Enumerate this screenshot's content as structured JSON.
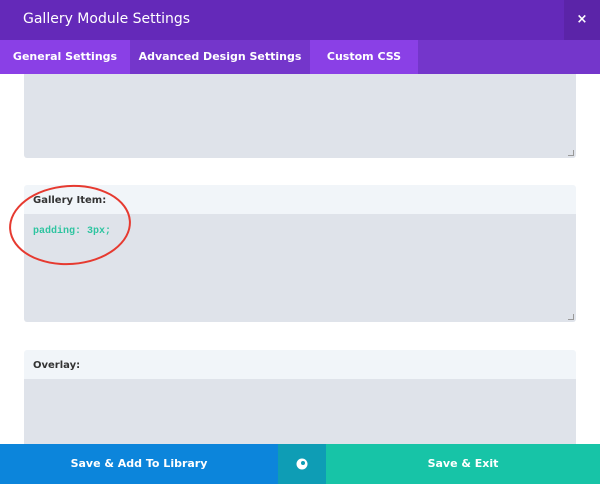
{
  "header": {
    "title": "Gallery Module Settings",
    "close_label": "×"
  },
  "tabs": [
    {
      "label": "General Settings"
    },
    {
      "label": "Advanced Design Settings"
    },
    {
      "label": "Custom CSS"
    }
  ],
  "fields": {
    "gallery_item": {
      "label": "Gallery Item:",
      "value": "padding: 3px;"
    },
    "overlay": {
      "label": "Overlay:",
      "value": ""
    }
  },
  "footer": {
    "save_library": "Save & Add To Library",
    "save_exit": "Save & Exit"
  },
  "colors": {
    "header": "#6429b9",
    "tabs": "#7436cb",
    "blue": "#0c85db",
    "teal": "#0e9db5",
    "green": "#17c4a7",
    "annotation": "#e63a30"
  }
}
